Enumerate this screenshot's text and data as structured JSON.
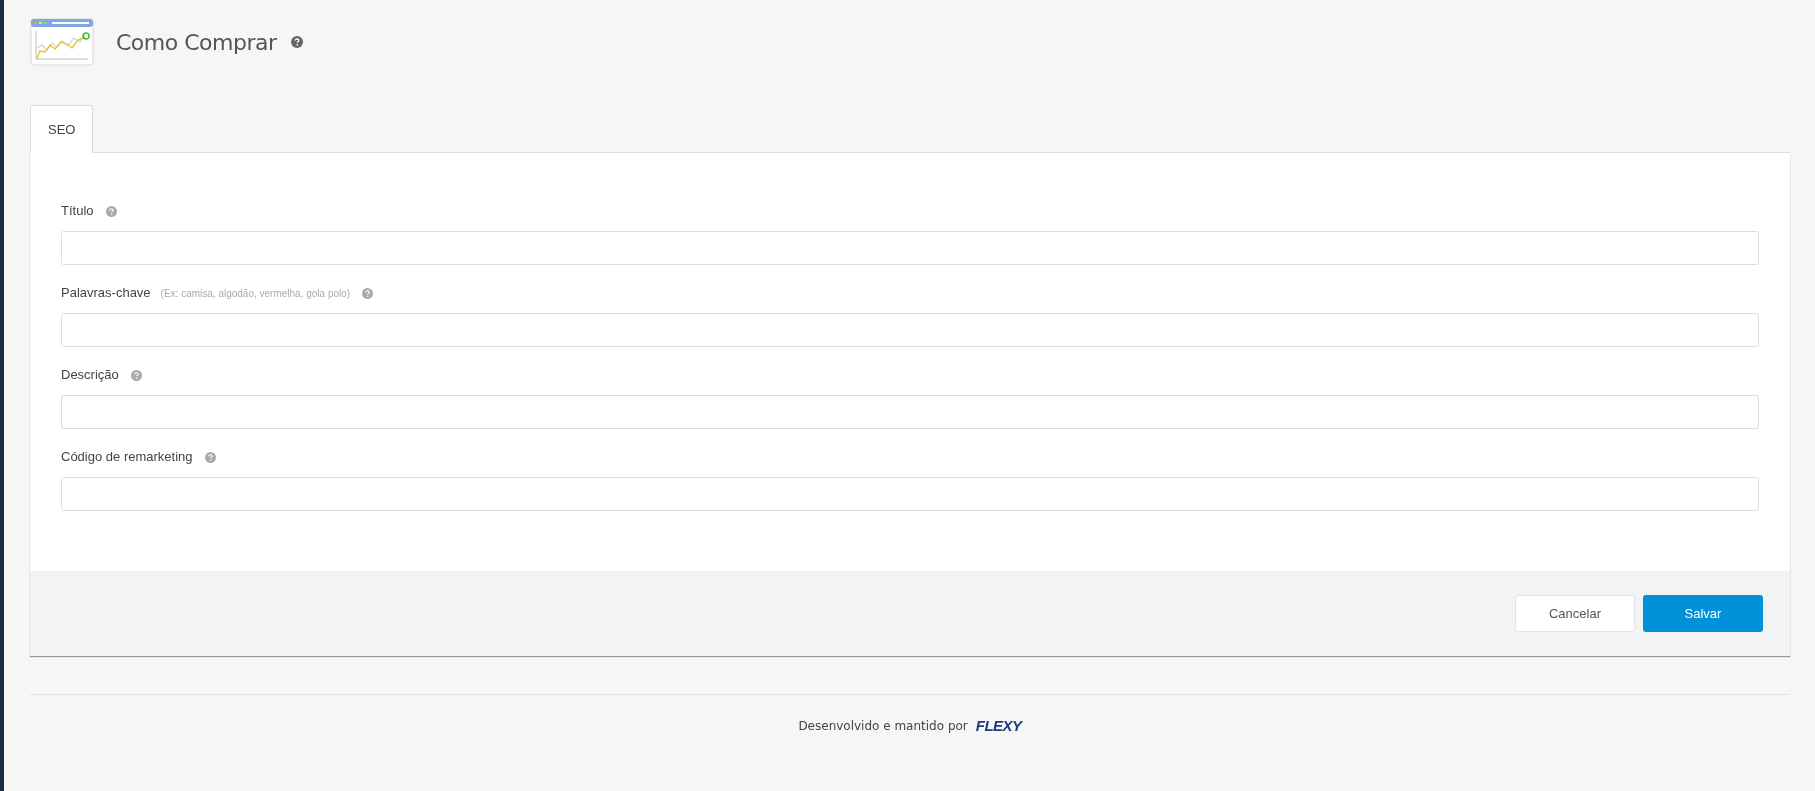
{
  "header": {
    "title": "Como Comprar"
  },
  "tabs": [
    {
      "label": "SEO",
      "selected": true
    }
  ],
  "form": {
    "fields": [
      {
        "label": "Título"
      },
      {
        "label": "Palavras-chave",
        "hint": "(Ex: camisa, algodão, vermelha, gola polo)"
      },
      {
        "label": "Descrição"
      },
      {
        "label": "Código de remarketing"
      }
    ]
  },
  "buttons": [
    {
      "label": "Cancelar",
      "kind": "secondary"
    },
    {
      "label": "Salvar",
      "kind": "primary"
    }
  ],
  "footer": {
    "text": "Desenvolvido e mantido por",
    "logo": "FLEXY"
  }
}
